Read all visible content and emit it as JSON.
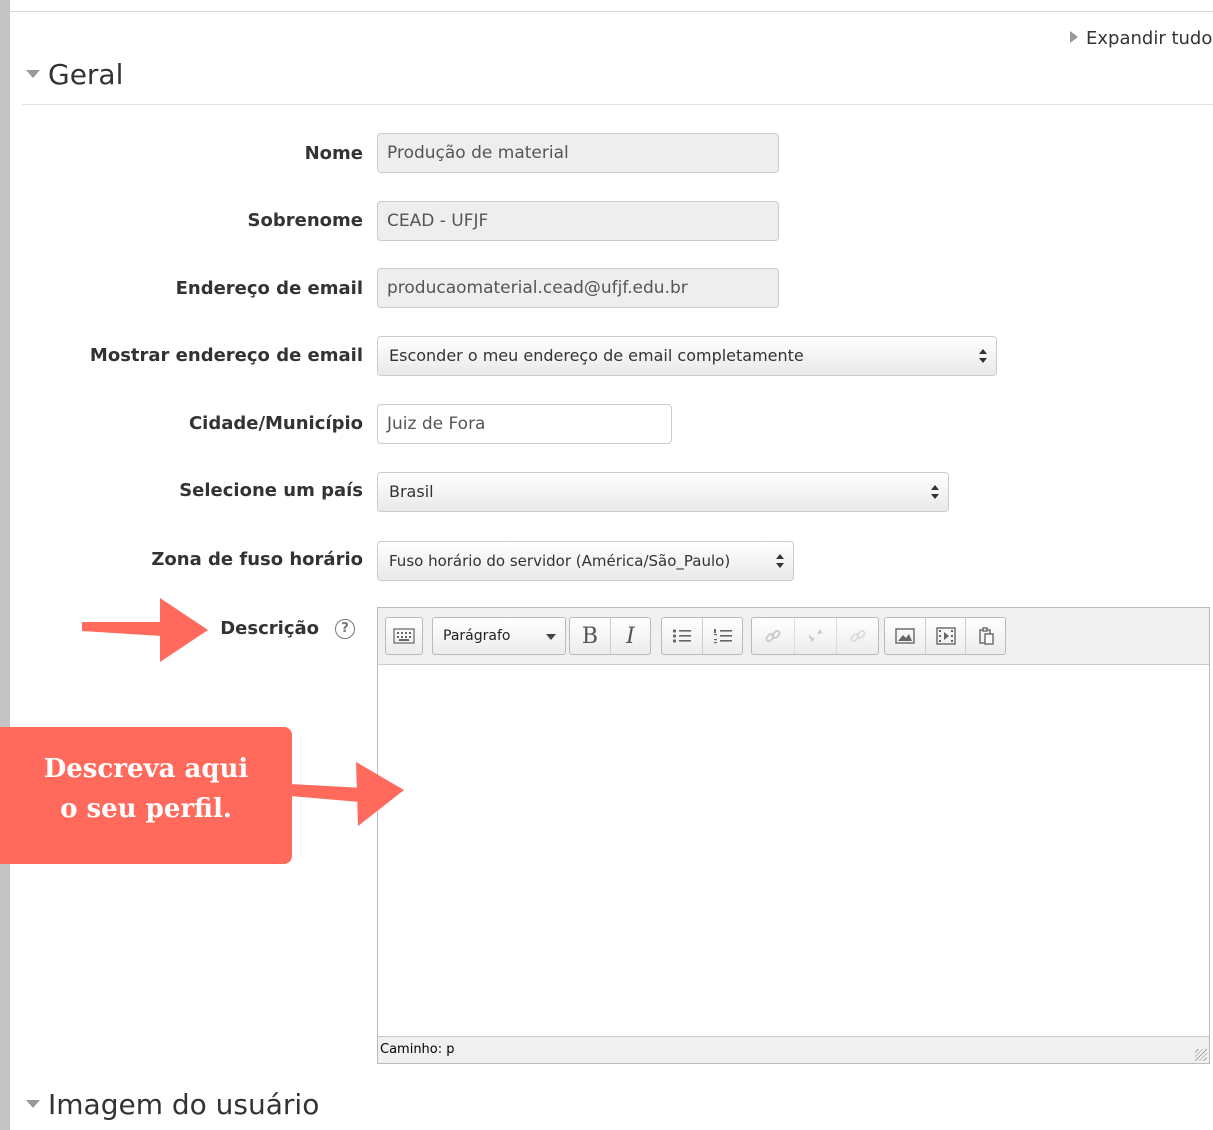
{
  "header": {
    "expand_all": "Expandir tudo"
  },
  "sections": {
    "general": "Geral",
    "user_image": "Imagem do usuário"
  },
  "fields": {
    "name_label": "Nome",
    "name_value": "Produção de material",
    "surname_label": "Sobrenome",
    "surname_value": "CEAD - UFJF",
    "email_label": "Endereço de email",
    "email_value": "producaomaterial.cead@ufjf.edu.br",
    "show_email_label": "Mostrar endereço de email",
    "show_email_value": "Esconder o meu endereço de email completamente",
    "city_label": "Cidade/Município",
    "city_value": "Juiz de Fora",
    "country_label": "Selecione um país",
    "country_value": "Brasil",
    "timezone_label": "Zona de fuso horário",
    "timezone_value": "Fuso horário do servidor (América/São_Paulo)",
    "description_label": "Descrição"
  },
  "editor": {
    "format_select": "Parágrafo",
    "path": "Caminho: p",
    "toolbar_icons": [
      "keyboard-icon",
      "bold-icon",
      "italic-icon",
      "bullet-list-icon",
      "numbered-list-icon",
      "link-icon",
      "unlink-icon",
      "anchor-icon",
      "image-icon",
      "media-icon",
      "paste-icon"
    ]
  },
  "callout": {
    "line1": "Descreva aqui",
    "line2": "o seu perfil.",
    "color": "#ff6a5c"
  }
}
